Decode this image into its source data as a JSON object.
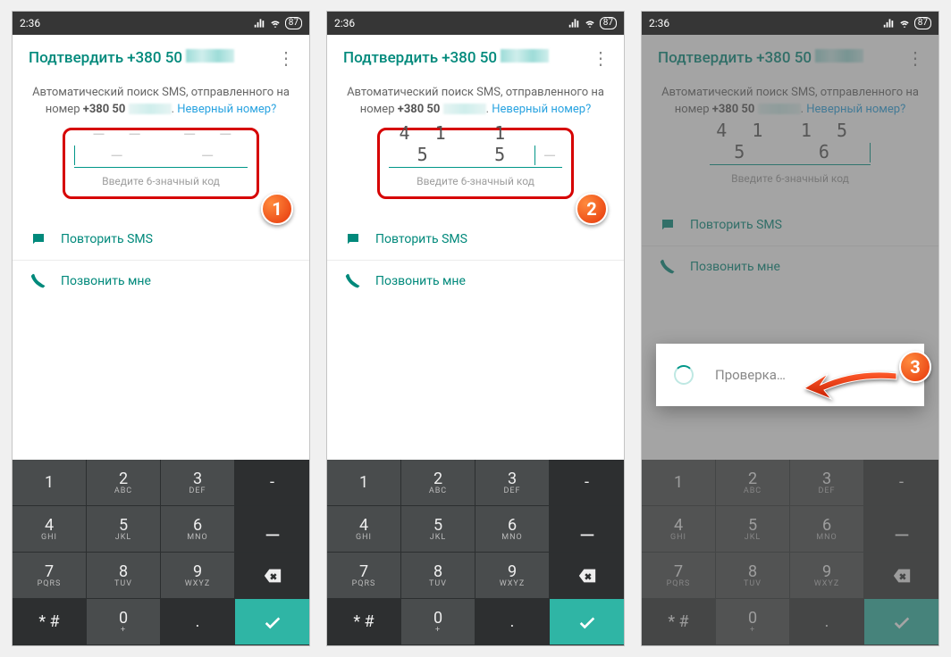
{
  "statusbar": {
    "time": "2:36",
    "battery": "87"
  },
  "header": {
    "title_prefix": "Подтвердить",
    "phone_prefix": "+380 50"
  },
  "instructions": {
    "line1": "Автоматический поиск SMS, отправленного на",
    "line2_prefix": "номер",
    "phone_bold": "+380 50",
    "wrong_number": "Неверный номер?"
  },
  "code_entry": {
    "hint": "Введите 6-значный код",
    "codes": {
      "screen1": {
        "g1": "– – –",
        "g2": "– – –"
      },
      "screen2": {
        "g1": "4 1 5",
        "g2": "1 5"
      },
      "screen3": {
        "g1": "4 1 5",
        "g2": "1 5 6"
      }
    }
  },
  "actions": {
    "resend": "Повторить SMS",
    "call": "Позвонить мне"
  },
  "dialog": {
    "verifying": "Проверка…"
  },
  "step_labels": {
    "s1": "1",
    "s2": "2",
    "s3": "3"
  },
  "keyboard": {
    "rows": [
      [
        {
          "n": "1",
          "s": ""
        },
        {
          "n": "2",
          "s": "ABC"
        },
        {
          "n": "3",
          "s": "DEF"
        },
        {
          "n": "-",
          "s": "",
          "dark": true
        }
      ],
      [
        {
          "n": "4",
          "s": "GHI"
        },
        {
          "n": "5",
          "s": "JKL"
        },
        {
          "n": "6",
          "s": "MNO"
        },
        {
          "n": "__",
          "s": "",
          "dark": true
        }
      ],
      [
        {
          "n": "7",
          "s": "PQRS"
        },
        {
          "n": "8",
          "s": "TUV"
        },
        {
          "n": "9",
          "s": "WXYZ"
        },
        {
          "icon": "backspace",
          "dark": true
        }
      ],
      [
        {
          "n": "* #",
          "s": "",
          "dark": true
        },
        {
          "n": "0",
          "s": "+"
        },
        {
          "n": ".",
          "s": "",
          "dark": true
        },
        {
          "icon": "check",
          "accent": true
        }
      ]
    ]
  }
}
